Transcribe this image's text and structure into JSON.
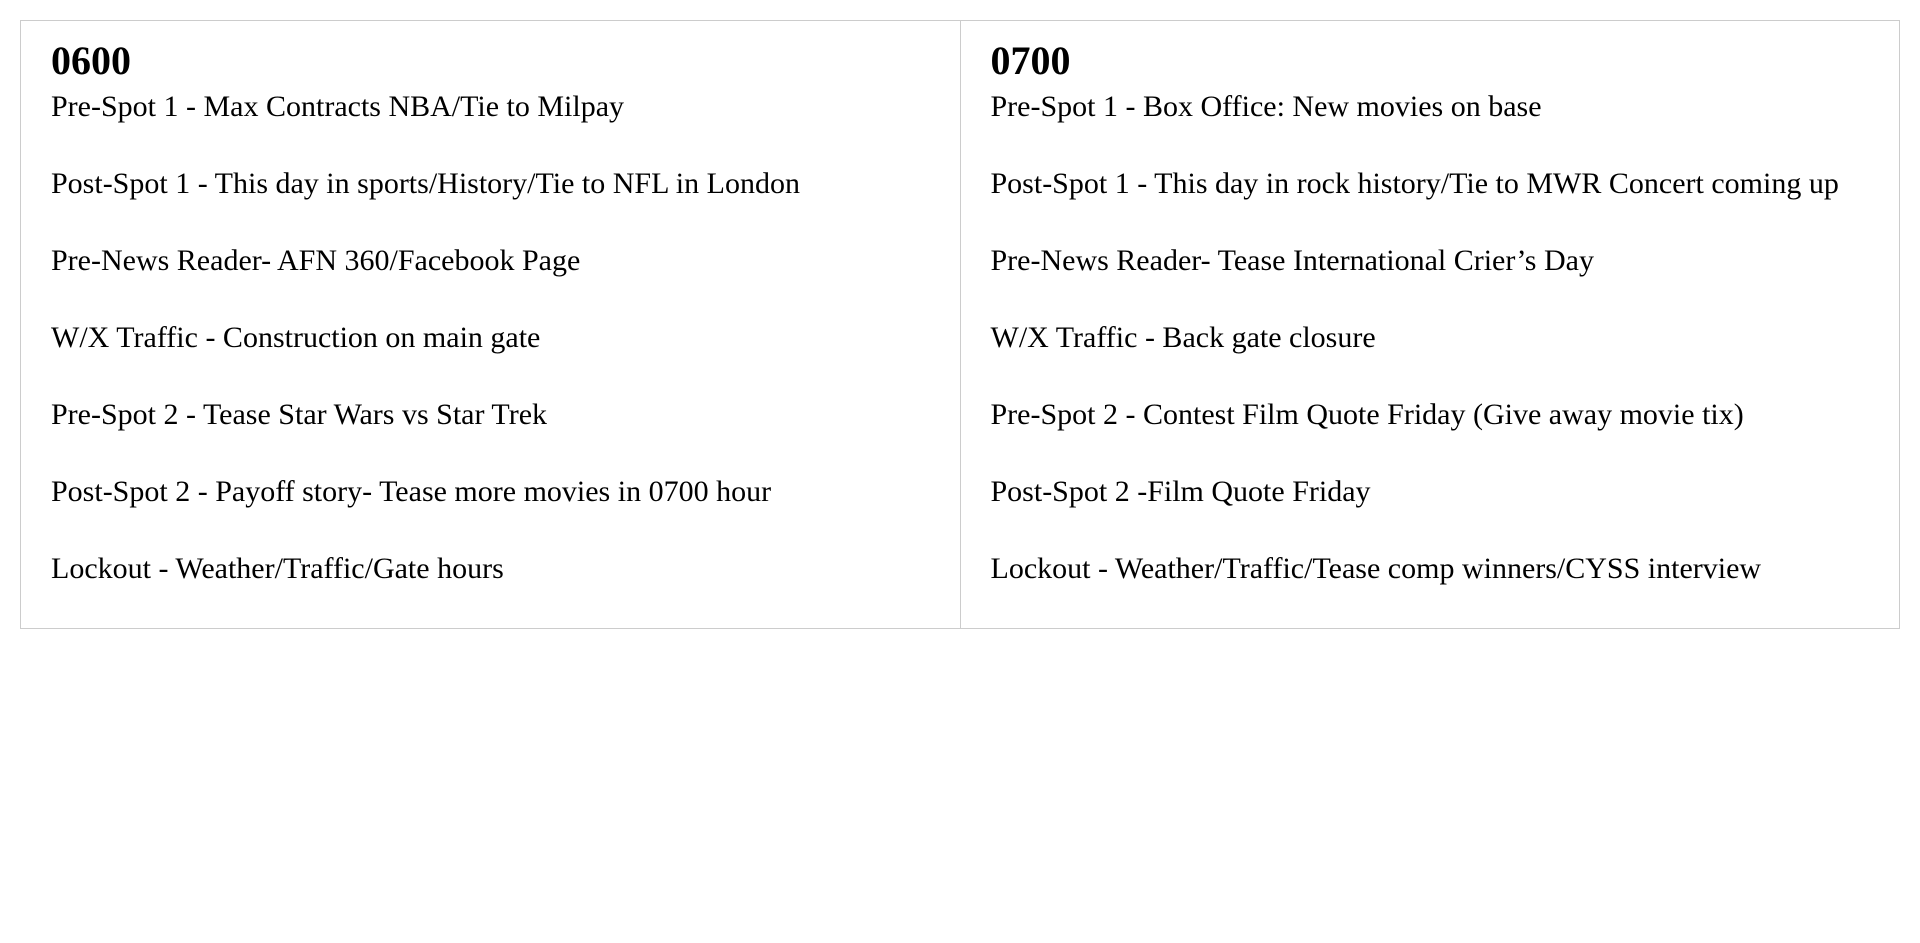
{
  "columns": [
    {
      "time_label": "0600",
      "entries": [
        "Pre-Spot 1 - Max Contracts NBA/Tie to Milpay",
        "Post-Spot 1 - This day in sports/History/Tie to NFL in London",
        "Pre-News Reader- AFN 360/Facebook Page",
        "W/X Traffic - Construction on main gate",
        "Pre-Spot 2 - Tease Star Wars vs Star Trek",
        "Post-Spot 2 - Payoff story- Tease more movies in 0700 hour",
        "Lockout - Weather/Traffic/Gate hours"
      ]
    },
    {
      "time_label": "0700",
      "entries": [
        "Pre-Spot 1 - Box Office: New movies on base",
        "Post-Spot 1 - This day in rock history/Tie to MWR Concert coming up",
        "Pre-News Reader- Tease International Crier’s Day",
        "W/X Traffic - Back gate closure",
        "Pre-Spot 2 - Contest Film Quote Friday (Give away movie tix)",
        "Post-Spot 2 -Film Quote Friday",
        "Lockout - Weather/Traffic/Tease comp winners/CYSS interview"
      ]
    }
  ]
}
